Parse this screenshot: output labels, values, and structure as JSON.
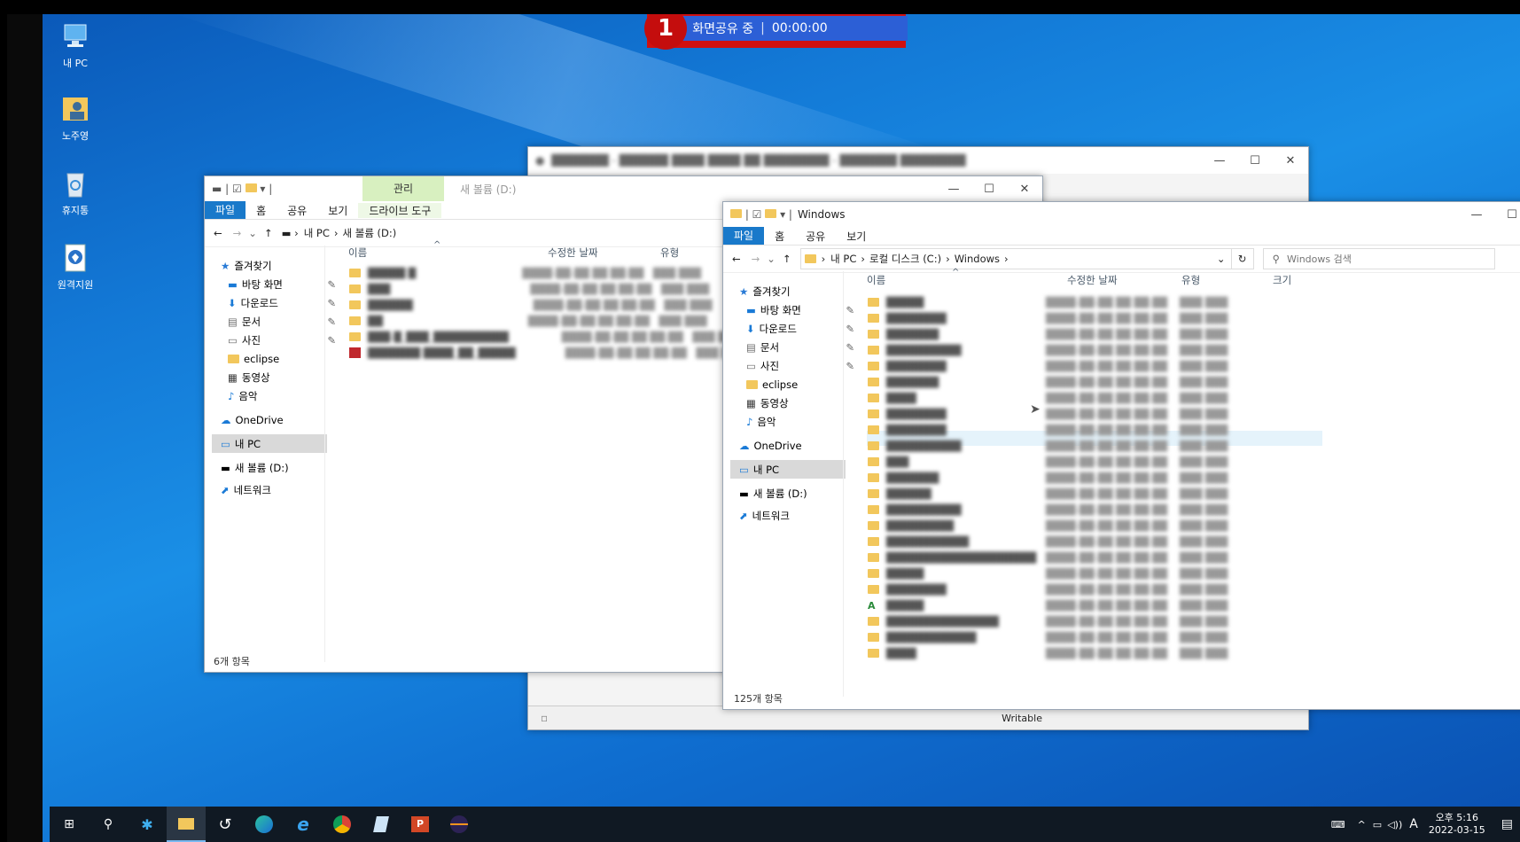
{
  "share_banner": {
    "badge": "1",
    "label": "화면공유 중",
    "time": "00:00:00"
  },
  "desktop_icons": [
    {
      "label": "내 PC",
      "icon": "pc-icon"
    },
    {
      "label": "노주영",
      "icon": "user-folder-icon"
    },
    {
      "label": "휴지통",
      "icon": "recycle-bin-icon"
    },
    {
      "label": "원격지원",
      "icon": "remote-support-icon"
    }
  ],
  "explorer_d": {
    "ribbon_context": "관리",
    "window_title": "새 볼륨 (D:)",
    "tabs": [
      "파일",
      "홈",
      "공유",
      "보기",
      "드라이브 도구"
    ],
    "breadcrumb": [
      "내 PC",
      "새 볼륨 (D:)"
    ],
    "nav": {
      "quick_access": "즐겨찾기",
      "items": [
        "바탕 화면",
        "다운로드",
        "문서",
        "사진",
        "eclipse",
        "동영상",
        "음악"
      ],
      "onedrive": "OneDrive",
      "this_pc": "내 PC",
      "volume": "새 볼륨 (D:)",
      "network": "네트워크"
    },
    "columns": [
      "이름",
      "수정한 날짜",
      "유형"
    ],
    "status": "6개 항목"
  },
  "eclipse_bg": {
    "status_text": "Writable"
  },
  "explorer_c": {
    "title": "Windows",
    "tabs": [
      "파일",
      "홈",
      "공유",
      "보기"
    ],
    "breadcrumb": [
      "내 PC",
      "로컬 디스크 (C:)",
      "Windows"
    ],
    "search_placeholder": "Windows 검색",
    "nav": {
      "quick_access": "즐겨찾기",
      "items": [
        "바탕 화면",
        "다운로드",
        "문서",
        "사진",
        "eclipse",
        "동영상",
        "음악"
      ],
      "onedrive": "OneDrive",
      "this_pc": "내 PC",
      "volume": "새 볼륨 (D:)",
      "network": "네트워크"
    },
    "columns": [
      "이름",
      "수정한 날짜",
      "유형",
      "크기"
    ],
    "status": "125개 항목"
  },
  "tray": {
    "time": "오후 5:16",
    "date": "2022-03-15",
    "ime": "A"
  }
}
